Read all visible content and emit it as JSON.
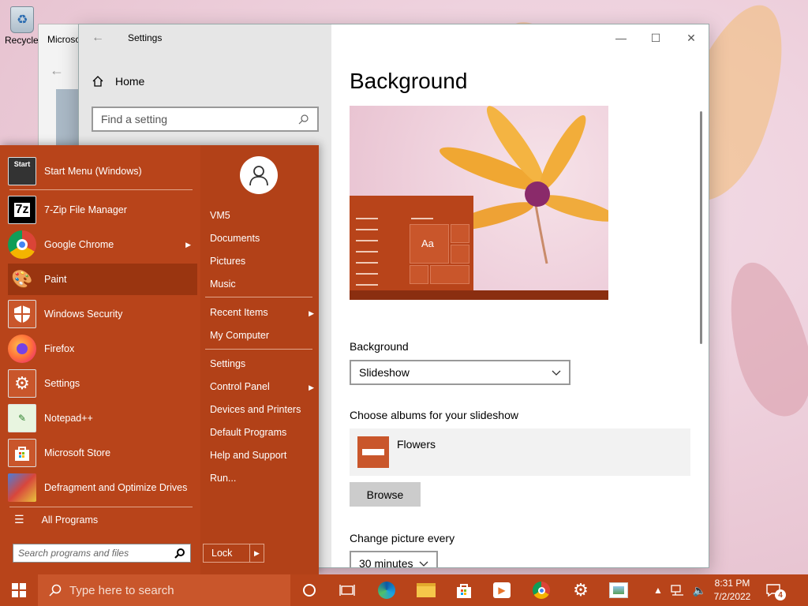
{
  "desktop": {
    "recycle_bin_label": "Recycle Bin",
    "bg_window_title": "Microso"
  },
  "settings": {
    "window_title": "Settings",
    "home_label": "Home",
    "find_placeholder": "Find a setting",
    "page_title": "Background",
    "preview_text": "Aa",
    "background_label": "Background",
    "background_value": "Slideshow",
    "albums_label": "Choose albums for your slideshow",
    "album_name": "Flowers",
    "browse_label": "Browse",
    "change_label": "Change picture every",
    "change_value": "30 minutes"
  },
  "start_menu": {
    "programs": [
      {
        "label": "Start Menu (Windows)",
        "icon": "start-menu-icon"
      },
      {
        "label": "7-Zip File Manager",
        "icon": "7zip-icon"
      },
      {
        "label": "Google Chrome",
        "icon": "chrome-icon",
        "submenu": true
      },
      {
        "label": "Paint",
        "icon": "paint-icon",
        "highlighted": true
      },
      {
        "label": "Windows Security",
        "icon": "shield-icon"
      },
      {
        "label": "Firefox",
        "icon": "firefox-icon"
      },
      {
        "label": "Settings",
        "icon": "gear-icon"
      },
      {
        "label": "Notepad++",
        "icon": "notepad-icon"
      },
      {
        "label": "Microsoft Store",
        "icon": "store-icon"
      },
      {
        "label": "Defragment and Optimize Drives",
        "icon": "defrag-icon"
      }
    ],
    "start_icon_text": "Start",
    "zip_icon_text": "7z",
    "all_programs": "All Programs",
    "search_placeholder": "Search programs and files",
    "right_items": [
      {
        "label": "VM5"
      },
      {
        "label": "Documents"
      },
      {
        "label": "Pictures"
      },
      {
        "label": "Music"
      },
      {
        "label": "Recent Items",
        "submenu": true
      },
      {
        "label": "My Computer"
      },
      {
        "label": "Settings"
      },
      {
        "label": "Control Panel",
        "submenu": true
      },
      {
        "label": "Devices and Printers"
      },
      {
        "label": "Default Programs"
      },
      {
        "label": "Help and Support"
      },
      {
        "label": "Run..."
      }
    ],
    "lock_label": "Lock"
  },
  "taskbar": {
    "search_placeholder": "Type here to search",
    "time": "8:31 PM",
    "date": "7/2/2022",
    "notification_count": "4"
  },
  "colors": {
    "accent": "#b8441a",
    "accent_dark": "#9a3510"
  }
}
